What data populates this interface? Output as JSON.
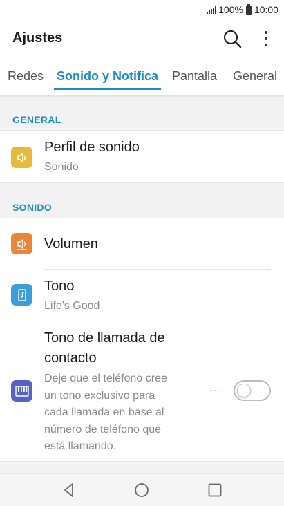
{
  "status_bar": {
    "battery_percent": "100%",
    "time": "10:00",
    "icons": [
      "signal-icon",
      "battery-icon"
    ]
  },
  "app_bar": {
    "title": "Ajustes",
    "icons": [
      "search-icon",
      "more-vert-icon"
    ]
  },
  "tabs": [
    {
      "label": "Redes",
      "active": false
    },
    {
      "label": "Sonido y Notificac",
      "active": true
    },
    {
      "label": "Pantalla",
      "active": false
    },
    {
      "label": "General",
      "active": false
    }
  ],
  "sections": {
    "general": {
      "header": "GENERAL",
      "items": [
        {
          "title": "Perfil de sonido",
          "subtitle": "Sonido",
          "icon": "speaker-icon",
          "icon_color": "#e8b93a"
        }
      ]
    },
    "sonido": {
      "header": "SONIDO",
      "items": [
        {
          "title": "Volumen",
          "icon": "volume-icon",
          "icon_color": "#e8873a"
        },
        {
          "title": "Tono",
          "subtitle": "Life's Good",
          "icon": "music-note-icon",
          "icon_color": "#3a9fd8"
        },
        {
          "title_line1": "Tono de llamada de",
          "title_line2": "contacto",
          "description_lines": [
            "Deje que el teléfono cree",
            "un tono exclusivo para",
            "cada llamada en base al",
            "número de teléfono que",
            "está llamando."
          ],
          "icon": "piano-keys-icon",
          "icon_color": "#5563c9",
          "more_label": "···",
          "toggle_on": false
        }
      ]
    }
  },
  "colors": {
    "accent": "#1b8cc9",
    "background": "#f2f2f2"
  },
  "nav_bar": {
    "icons": [
      "back-icon",
      "home-icon",
      "recents-icon"
    ]
  }
}
